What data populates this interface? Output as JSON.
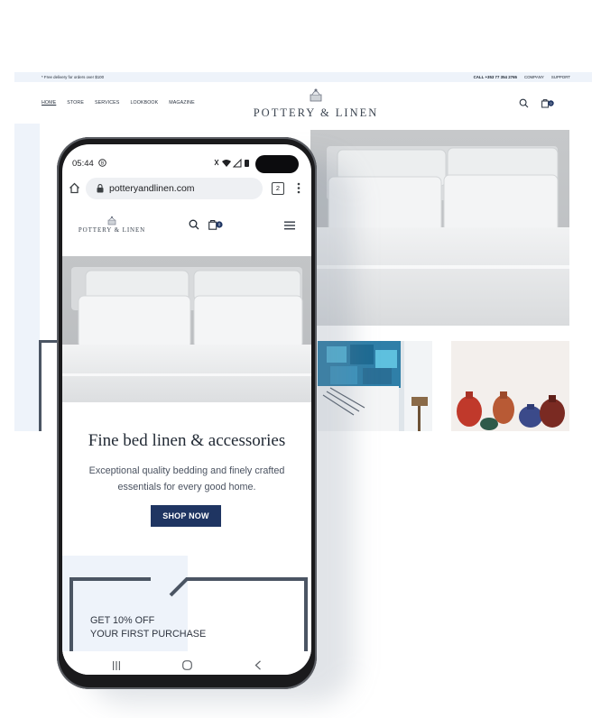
{
  "desktop": {
    "topbar": {
      "promo": "* Free delivery for orders over $100",
      "call": "CALL +353 77 354 2765",
      "company": "COMPANY",
      "support": "SUPPORT"
    },
    "nav": [
      "HOME",
      "STORE",
      "SERVICES",
      "LOOKBOOK",
      "MAGAZINE"
    ],
    "brand": "POTTERY & LINEN",
    "cart_count": "0"
  },
  "mobile": {
    "status": {
      "time": "05:44"
    },
    "browser": {
      "url": "potteryandlinen.com",
      "tab_count": "2"
    },
    "brand": "POTTERY & LINEN",
    "cart_count": "0",
    "hero": {
      "heading": "Fine bed linen & accessories",
      "subtext_line1": "Exceptional quality bedding and finely crafted",
      "subtext_line2": "essentials for every good home.",
      "cta": "SHOP NOW"
    },
    "promo": {
      "line1": "GET 10% OFF",
      "line2": "YOUR FIRST PURCHASE"
    }
  },
  "colors": {
    "navy": "#1f3562",
    "light_panel": "#eef3fa",
    "text_dark": "#222a35"
  }
}
